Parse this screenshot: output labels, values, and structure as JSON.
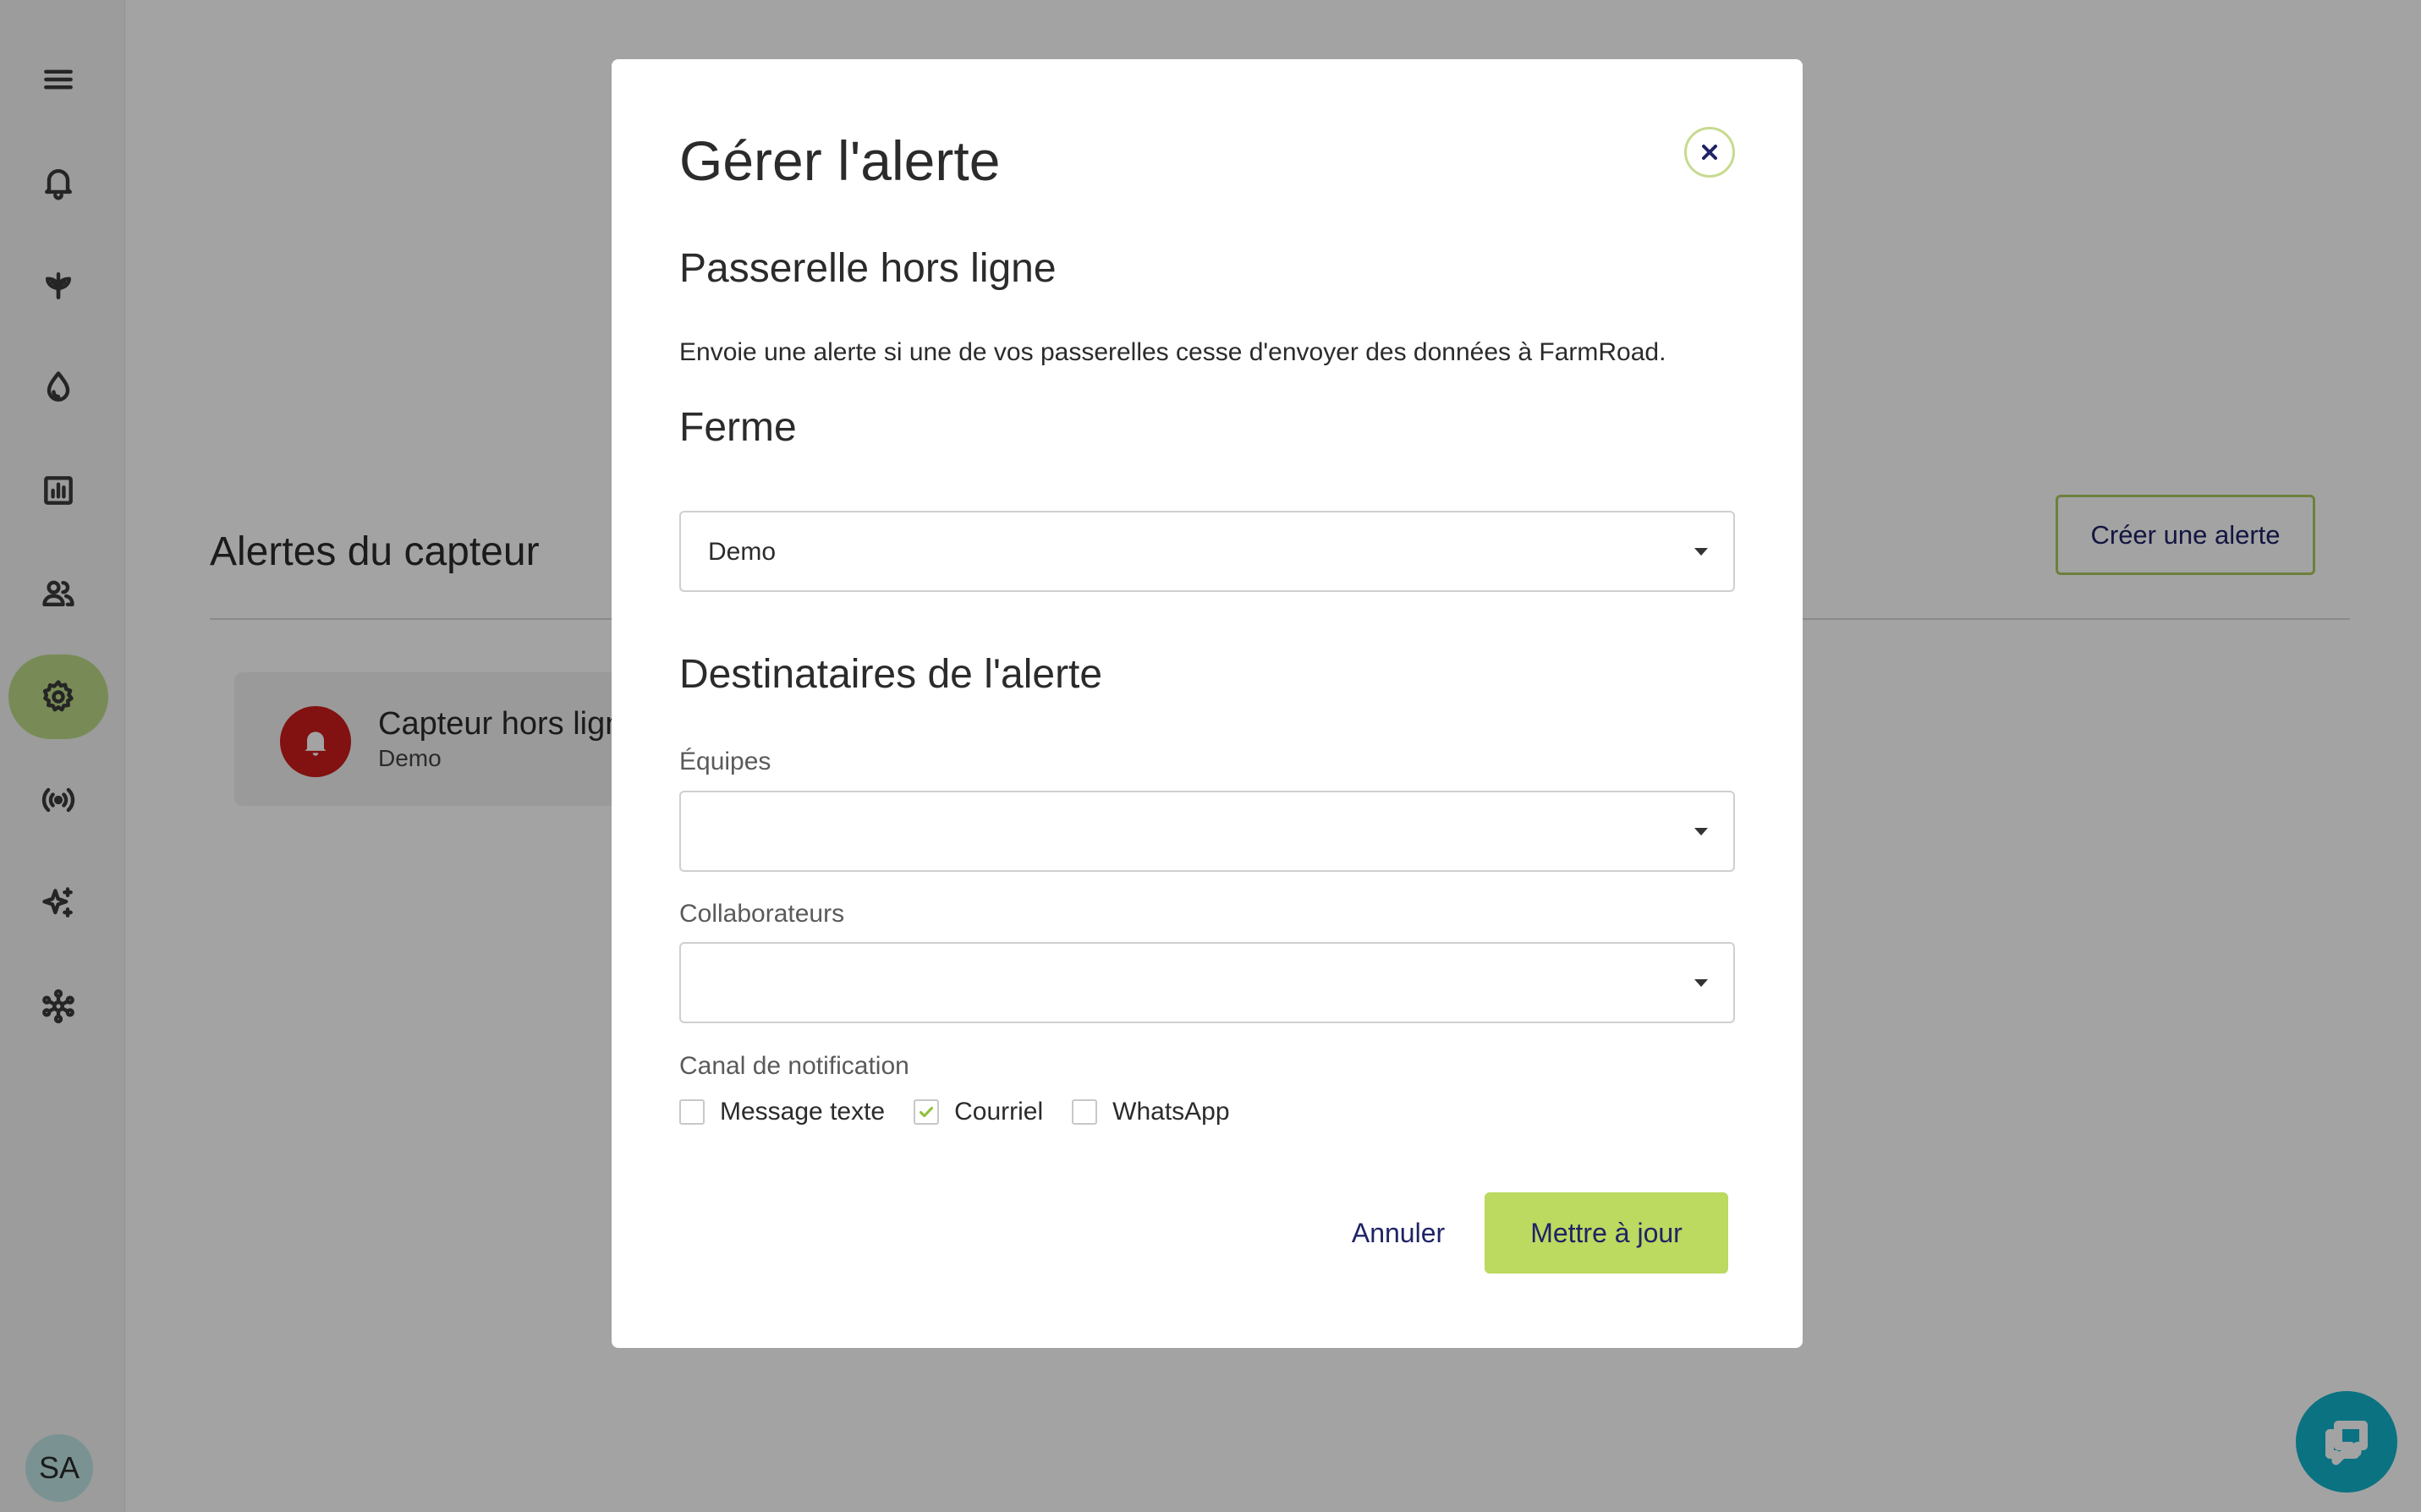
{
  "sidebar": {
    "icons": [
      "menu-icon",
      "bell-icon",
      "plant-icon",
      "water-drop-icon",
      "bar-chart-icon",
      "people-icon",
      "gear-icon",
      "broadcast-icon",
      "sparkle-icon",
      "network-icon"
    ],
    "active": "gear-icon",
    "avatar_initials": "SA"
  },
  "main": {
    "title": "Alertes du capteur",
    "create_button": "Créer une alerte",
    "alert_card": {
      "title": "Capteur hors ligne",
      "subtitle": "Demo"
    }
  },
  "modal": {
    "title": "Gérer l'alerte",
    "alert_type": "Passerelle hors ligne",
    "description": "Envoie une alerte si une de vos passerelles cesse d'envoyer des données à FarmRoad.",
    "farm_heading": "Ferme",
    "farm_value": "Demo",
    "recipients_heading": "Destinataires de l'alerte",
    "teams_label": "Équipes",
    "teams_value": "",
    "collaborators_label": "Collaborateurs",
    "collaborators_value": "",
    "channel_label": "Canal de notification",
    "channels": [
      {
        "label": "Message texte",
        "checked": false
      },
      {
        "label": "Courriel",
        "checked": true
      },
      {
        "label": "WhatsApp",
        "checked": false
      }
    ],
    "cancel_label": "Annuler",
    "update_label": "Mettre à jour"
  },
  "colors": {
    "accent_green": "#bcd960",
    "navy_text": "#1f2366",
    "alert_red": "#cc1c1c",
    "chat_teal": "#12b3cc"
  }
}
